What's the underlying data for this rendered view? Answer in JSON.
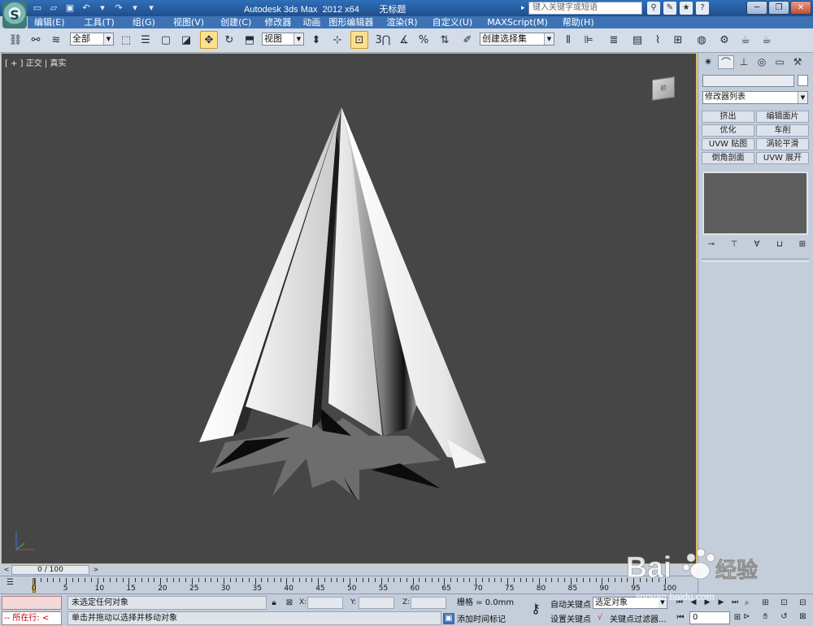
{
  "title_bar": {
    "title": "Autodesk 3ds Max  2012 x64        无标题",
    "search_placeholder": "键入关键字或短语",
    "window_buttons": [
      "─",
      "❐",
      "✕"
    ]
  },
  "menu": {
    "items": [
      "编辑(E)",
      "工具(T)",
      "组(G)",
      "视图(V)",
      "创建(C)",
      "修改器",
      "动画",
      "图形编辑器",
      "渲染(R)",
      "自定义(U)",
      "MAXScript(M)",
      "帮助(H)"
    ]
  },
  "toolbar": {
    "selection_filter": "全部",
    "reference_coord": "视图",
    "named_selection": "创建选择集",
    "snap_labels": [
      "3",
      "2.5",
      "%"
    ]
  },
  "viewport": {
    "label": "[ + ] 正交 | 真实 ",
    "viewcube_label": "前",
    "shading": "smooth-gray"
  },
  "command_panel": {
    "tabs": [
      "create-icon",
      "modify-icon",
      "hierarchy-icon",
      "motion-icon",
      "display-icon",
      "utilities-icon"
    ],
    "active_tab": 1,
    "modifier_list": "修改器列表",
    "modifier_buttons": [
      "挤出",
      "编辑面片",
      "优化",
      "车削",
      "UVW 贴图",
      "涡轮平滑",
      "倒角剖面",
      "UVW 展开"
    ]
  },
  "timeline": {
    "frame_display": "0 / 100",
    "ticks": [
      "0",
      "5",
      "10",
      "15",
      "20",
      "25",
      "30",
      "35",
      "40",
      "45",
      "50",
      "55",
      "60",
      "65",
      "70",
      "75",
      "80",
      "85",
      "90",
      "95",
      "100"
    ]
  },
  "status": {
    "script_run": "-- 所在行:  <",
    "selection_status": "未选定任何对象",
    "prompt": "单击并拖动以选择并移动对象",
    "x_label": "X:",
    "y_label": "Y:",
    "z_label": "Z:",
    "grid": "栅格 = 0.0mm",
    "add_time_tag": "添加时间标记",
    "auto_key": "自动关键点",
    "set_key": "设置关键点",
    "selected_drop": "选定对象",
    "key_filters": "关键点过滤器...",
    "current_frame": "0"
  },
  "watermark": {
    "brand": "Bai",
    "brand_tail": "经验",
    "url": "jingyan.baidu.com"
  }
}
